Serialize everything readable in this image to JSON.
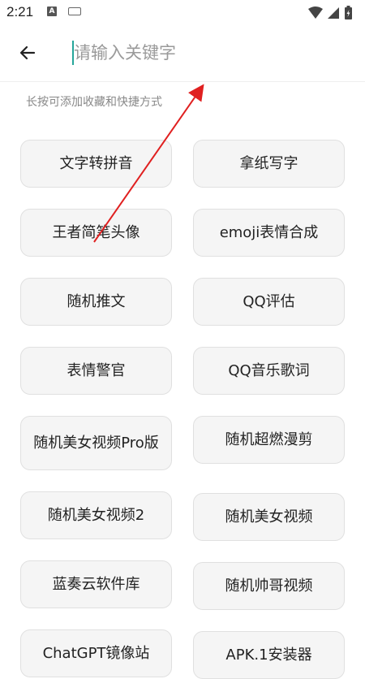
{
  "status_bar": {
    "time": "2:21",
    "notification_icon": "A",
    "icons": [
      "wifi-icon",
      "cellular-icon",
      "battery-charging-icon"
    ]
  },
  "toolbar": {
    "back_icon": "arrow-left-icon",
    "search_placeholder": "请输入关键字",
    "search_value": ""
  },
  "hint": "长按可添加收藏和快捷方式",
  "tools_left": [
    "文字转拼音",
    "王者简笔头像",
    "随机推文",
    "表情警官",
    "随机美女视频Pro版",
    "随机美女视频2",
    "蓝奏云软件库",
    "ChatGPT镜像站"
  ],
  "tools_right": [
    "拿纸写字",
    "emoji表情合成",
    "QQ评估",
    "QQ音乐歌词",
    "随机超燃漫剪",
    "随机美女视频",
    "随机帅哥视频",
    "APK.1安装器"
  ],
  "colors": {
    "accent": "#26a69a",
    "annotation_arrow": "#e02020",
    "card_bg": "#f5f5f5",
    "card_border": "#e0e0e0"
  }
}
